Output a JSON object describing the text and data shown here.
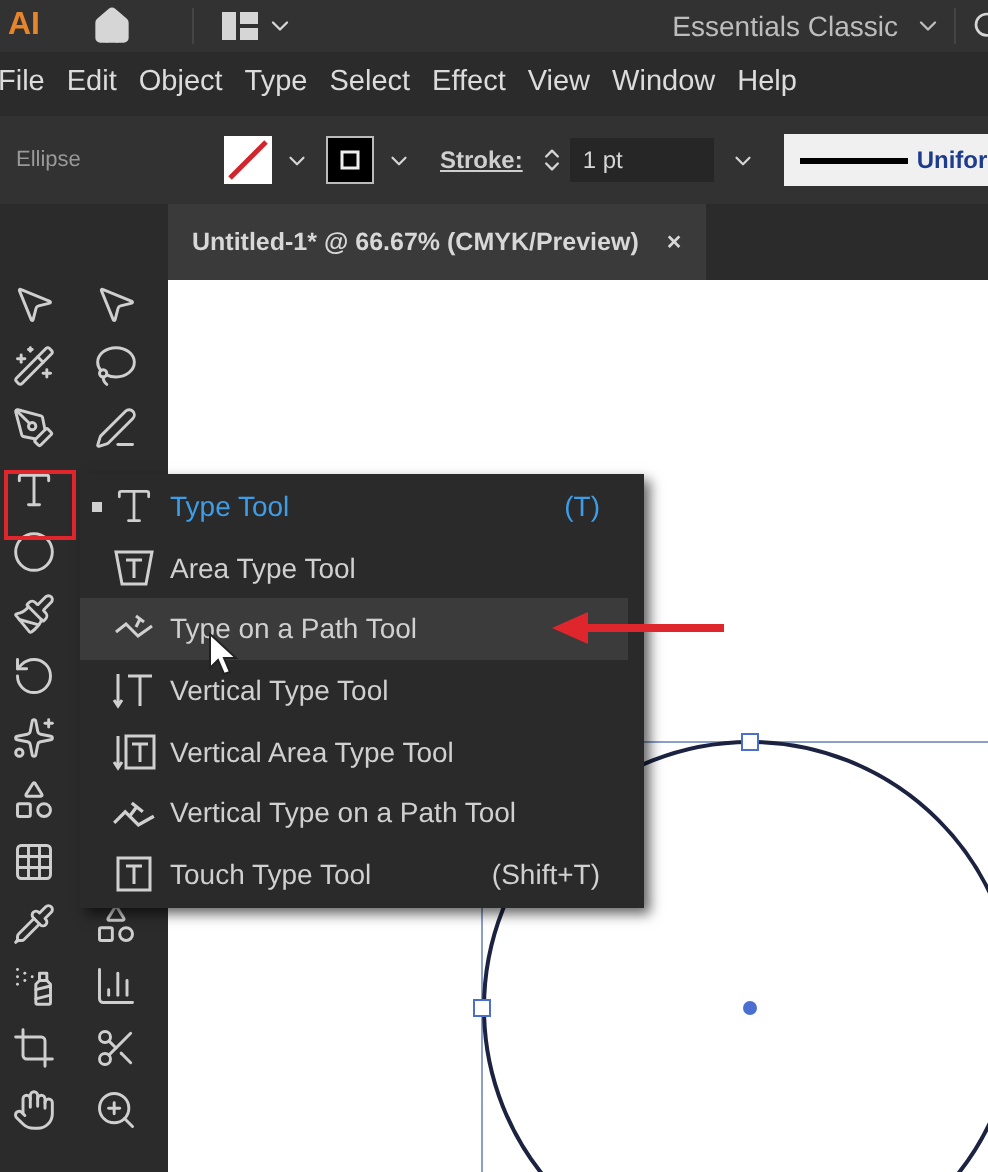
{
  "app_bar": {
    "logo": "AI",
    "workspace": "Essentials Classic"
  },
  "menu_bar": [
    "File",
    "Edit",
    "Object",
    "Type",
    "Select",
    "Effect",
    "View",
    "Window",
    "Help"
  ],
  "control_bar": {
    "object_label": "Ellipse",
    "stroke_label": "Stroke:",
    "stroke_weight": "1 pt",
    "profile": "Unifor"
  },
  "document_tab": {
    "title": "Untitled-1* @ 66.67% (CMYK/Preview)",
    "close": "×"
  },
  "flyout_menu": [
    {
      "kind": "type",
      "label": "Type Tool",
      "shortcut": "(T)",
      "selected": true,
      "hovered": false
    },
    {
      "kind": "area",
      "label": "Area Type Tool",
      "selected": false,
      "hovered": false
    },
    {
      "kind": "path",
      "label": "Type on a Path Tool",
      "selected": false,
      "hovered": true
    },
    {
      "kind": "vertical",
      "label": "Vertical Type Tool",
      "selected": false,
      "hovered": false
    },
    {
      "kind": "vertical-area",
      "label": "Vertical Area Type Tool",
      "selected": false,
      "hovered": false
    },
    {
      "kind": "vertical-path",
      "label": "Vertical Type on a Path Tool",
      "selected": false,
      "hovered": false
    },
    {
      "kind": "touch",
      "label": "Touch Type Tool",
      "shortcut": "(Shift+T)",
      "selected": false,
      "hovered": false
    }
  ]
}
